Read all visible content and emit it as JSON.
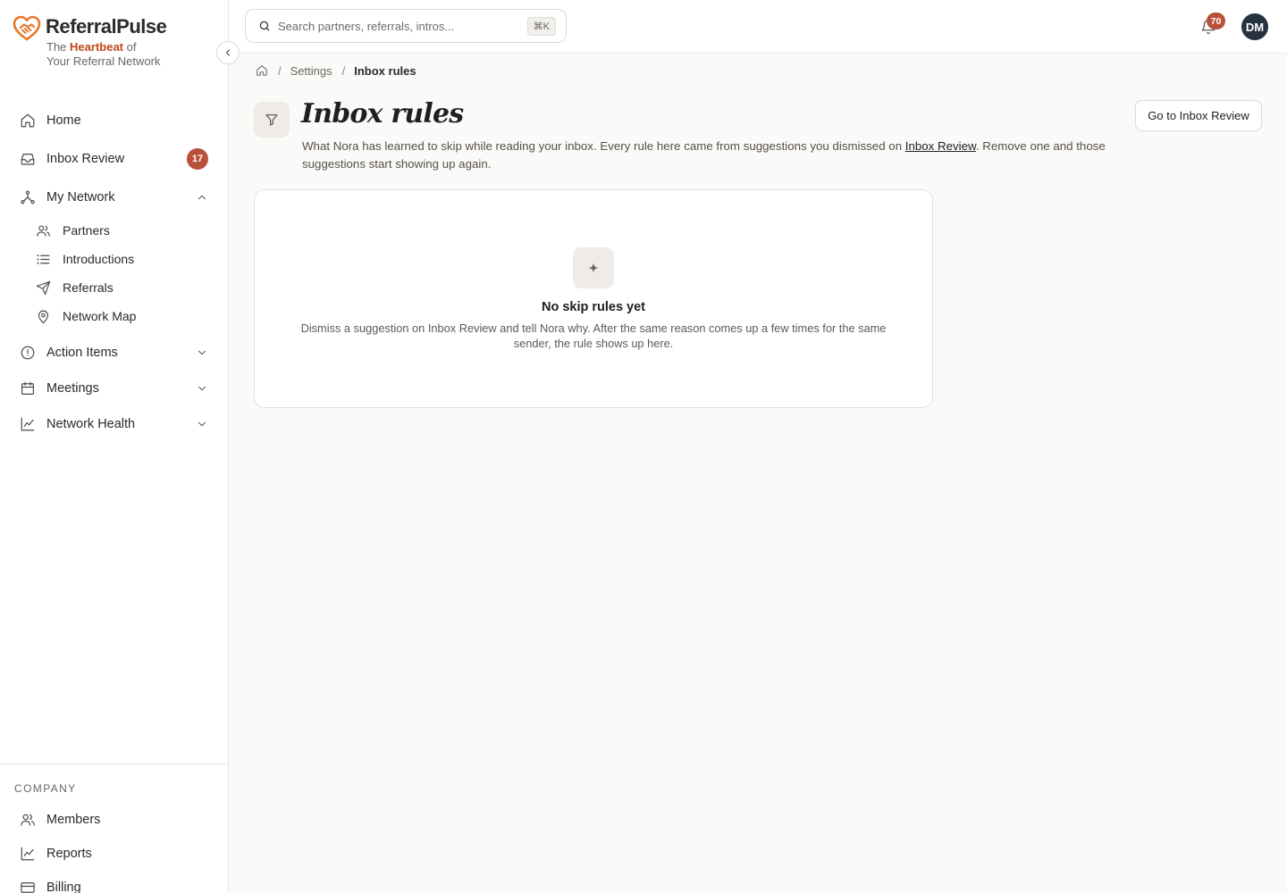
{
  "brand": {
    "name": "ReferralPulse",
    "tagline_pre": "The",
    "tagline_highlight": "Heartbeat",
    "tagline_mid": "of",
    "tagline_line2": "Your Referral Network",
    "accent": "#c0471a"
  },
  "sidebar": {
    "items": [
      {
        "label": "Home",
        "icon": "home-icon"
      },
      {
        "label": "Inbox Review",
        "icon": "inbox-icon",
        "badge": "17"
      },
      {
        "label": "My Network",
        "icon": "network-icon",
        "expanded": true
      },
      {
        "label": "Action Items",
        "icon": "alert-circle-icon"
      },
      {
        "label": "Meetings",
        "icon": "calendar-icon"
      },
      {
        "label": "Network Health",
        "icon": "chart-line-icon"
      }
    ],
    "network_children": [
      {
        "label": "Partners",
        "icon": "users-icon"
      },
      {
        "label": "Introductions",
        "icon": "list-icon"
      },
      {
        "label": "Referrals",
        "icon": "send-icon"
      },
      {
        "label": "Network Map",
        "icon": "map-pin-icon"
      }
    ],
    "company": {
      "title": "COMPANY",
      "items": [
        {
          "label": "Members",
          "icon": "users-icon"
        },
        {
          "label": "Reports",
          "icon": "chart-line-icon"
        },
        {
          "label": "Billing",
          "icon": "credit-card-icon"
        }
      ]
    }
  },
  "topbar": {
    "search_placeholder": "Search partners, referrals, intros...",
    "shortcut": "⌘K",
    "notification_count": "70",
    "avatar_initials": "DM"
  },
  "breadcrumb": {
    "items": [
      "Settings",
      "Inbox rules"
    ]
  },
  "page": {
    "title": "Inbox rules",
    "description_pre": "What Nora has learned to skip while reading your inbox. Every rule here came from suggestions you dismissed on ",
    "description_link": "Inbox Review",
    "description_post": ". Remove one and those suggestions start showing up again.",
    "action_button": "Go to Inbox Review"
  },
  "empty_state": {
    "title": "No skip rules yet",
    "description": "Dismiss a suggestion on Inbox Review and tell Nora why. After the same reason comes up a few times for the same sender, the rule shows up here."
  },
  "colors": {
    "badge": "#b9503a",
    "avatar_bg": "#26323f",
    "background": "#fbfaf8"
  }
}
